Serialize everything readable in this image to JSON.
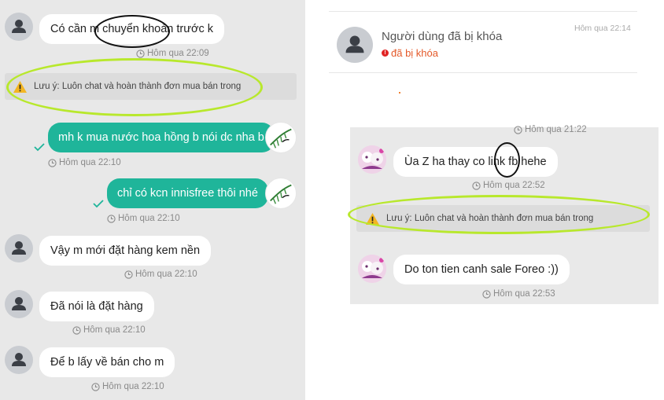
{
  "left": {
    "messages": [
      {
        "text": "Có cần m chuyển khoản trước k",
        "time": "Hôm qua 22:09"
      },
      {
        "text": "mh k mua nước hoa hồng b nói dc nha b",
        "time": "Hôm qua 22:10"
      },
      {
        "text": "chỉ có kcn innisfree thôi nhé",
        "time": "Hôm qua 22:10"
      },
      {
        "text": "Vậy m mới đặt hàng kem nền",
        "time": "Hôm qua 22:10"
      },
      {
        "text": "Đã nói là đặt hàng",
        "time": "Hôm qua 22:10"
      },
      {
        "text": "Để b lấy về bán cho m",
        "time": "Hôm qua 22:10"
      }
    ],
    "notice": "Lưu ý: Luôn chat và hoàn thành đơn mua bán trong"
  },
  "right": {
    "header": {
      "name": "Người dùng đã bị khóa",
      "status": "đã bị khóa",
      "time": "Hôm qua 22:14"
    },
    "top_time": "Hôm qua 21:22",
    "messages": [
      {
        "text": "Ùa Z ha thay co link fb hehe",
        "time": "Hôm qua 22:52"
      },
      {
        "text": "Do ton tien canh sale Foreo :))",
        "time": "Hôm qua 22:53"
      }
    ],
    "notice": "Lưu ý: Luôn chat và hoàn thành đơn mua bán trong"
  },
  "colors": {
    "outgoing_bubble": "#1fb59a",
    "highlight_green": "#b8e82c",
    "blocked_red": "#e45a2a"
  }
}
